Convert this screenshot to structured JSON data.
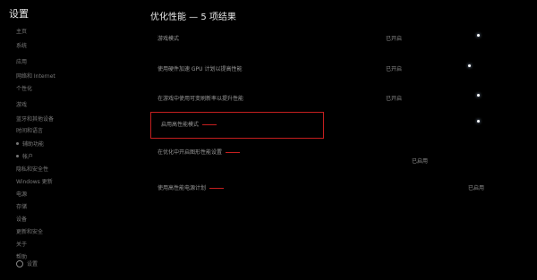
{
  "app": {
    "settings_title": "设置",
    "page_title": "优化性能 — 5 项结果"
  },
  "sidebar": {
    "items": [
      {
        "label": "主页"
      },
      {
        "label": "系统"
      },
      {
        "label": "应用"
      },
      {
        "label": "网络和 Internet"
      },
      {
        "label": "个性化"
      },
      {
        "label": "游戏"
      },
      {
        "label": "蓝牙和其他设备"
      },
      {
        "label": "时间和语言"
      },
      {
        "label": "辅助功能"
      },
      {
        "label": "帐户"
      },
      {
        "label": "隐私和安全性"
      },
      {
        "label": "Windows 更新"
      },
      {
        "label": "电源"
      },
      {
        "label": "存储"
      },
      {
        "label": "设备"
      },
      {
        "label": "更新和安全"
      },
      {
        "label": "关于"
      },
      {
        "label": "帮助"
      },
      {
        "label": "设置"
      }
    ]
  },
  "results": [
    {
      "label": "游戏模式",
      "value": "已开启",
      "toggle": "on"
    },
    {
      "label": "使用硬件加速 GPU 计划以提高性能",
      "value": "已开启",
      "toggle": "on"
    },
    {
      "label": "在游戏中使用可变刷新率以提升性能",
      "value": "已开启",
      "toggle": "on"
    },
    {
      "label": "启用高性能模式",
      "value": "",
      "toggle": "on"
    },
    {
      "label": "在优化中开启图形性能设置",
      "value": "已启用"
    },
    {
      "label": "使用高性能电源计划",
      "value": "已启用"
    }
  ]
}
